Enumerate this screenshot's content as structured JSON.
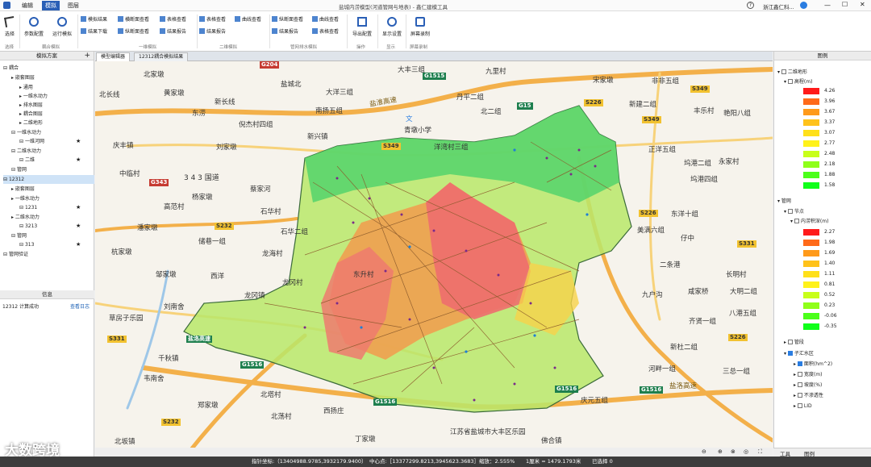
{
  "menu": {
    "file_icon": "app-icon",
    "items": [
      "编辑",
      "模拟",
      "图层"
    ],
    "active": "模拟"
  },
  "window": {
    "title": "盐城内涝模型(河道管网与地表) - 鑫仁建模工具",
    "user": "浙江鑫仁科...",
    "help_icon": "help-icon"
  },
  "ribbon": {
    "select": "选择",
    "param": "参数配置",
    "run": "运行模拟",
    "result_view": "模拟结果",
    "result_download": "结果下载",
    "h_section_view": "横断面查看",
    "v_section_view": "纵断面查看",
    "table_view": "表格查看",
    "result_report": "结果报告",
    "table_view2": "表格查看",
    "result_report2": "结果报告",
    "curve_view": "曲线查看",
    "v_section_view2": "纵断面查看",
    "result_report3": "结果报告",
    "curve_view2": "曲线查看",
    "table_view3": "表格查看",
    "export": "导出配置",
    "display": "显示设置",
    "record": "屏幕录制",
    "groups": {
      "g1": "选择",
      "g2": "耦合模拟",
      "g3": "一维模拟",
      "g4": "二维模拟",
      "g5": "管网排水模拟",
      "g6": "操作",
      "g7": "显示",
      "g8": "屏幕录制"
    }
  },
  "left": {
    "header": "模拟方案",
    "tree": [
      "耦合",
      "嵌套图层",
      "通用",
      "一维水动力",
      "排水图层",
      "耦合图层",
      "二维地形",
      "一维水动力",
      "一维河网",
      "二维水动力",
      "二维",
      "管网",
      "12312",
      "嵌套图层",
      "一维水动力",
      "1231",
      "二维水动力",
      "3213",
      "管网",
      "313",
      "管网验证"
    ],
    "info_header": "信息",
    "info_text": "12312 计算成功",
    "info_link": "查看日志"
  },
  "tabs": [
    "模型编辑器",
    "12312耦合模拟结果"
  ],
  "map": {
    "labels": [
      "北家墩",
      "黄家墩",
      "北长线",
      "新长线",
      "东涝",
      "倪杰村四组",
      "刘家墩",
      "庆丰镇",
      "中临村",
      "蔡家河",
      "杨家墩",
      "高范村",
      "潘家墩",
      "储巷一组",
      "杭家墩",
      "邹家墩",
      "西洋",
      "刘南舍",
      "草房子乐园",
      "千秋镇",
      "韦南舍",
      "郑家墩",
      "北坂镇",
      "北荡村",
      "北塔村",
      "西扬庄",
      "丁家墩",
      "江苏省盐城市大丰区乐园",
      "佛合镇",
      "大丰三组",
      "盐城北",
      "大洋三组",
      "南扬五组",
      "青墩小学",
      "洋湾村三组",
      "丹平二组",
      "新兴镇",
      "九里村",
      "北二组",
      "宋家墩",
      "非非五组",
      "新建二组",
      "丰乐村",
      "艳阳八组",
      "正洋五组",
      "坞港二组",
      "坞港四组",
      "美满六组",
      "东洋十组",
      "仔中",
      "二条港",
      "长明村",
      "大明二组",
      "永家村",
      "咸家桥",
      "八港五组",
      "九户沟",
      "齐贤一组",
      "新杜二组",
      "河畔一组",
      "三总一组",
      "庆元五组",
      "龙海村",
      "石华村",
      "石华二组",
      "龙冈镇",
      "龙冈村",
      "东升村"
    ],
    "roads": [
      "G204",
      "S349",
      "G1515",
      "G15",
      "S226",
      "S331",
      "S232",
      "G343",
      "G1516",
      "G228",
      "3 4 3 国道",
      "盐淮高速",
      "盐洛高速"
    ],
    "icon_doc": "文"
  },
  "legend": {
    "header": "图例",
    "sec1": "二维地形",
    "sec1_item": "高程(m)",
    "elev_values": [
      "4.26",
      "3.96",
      "3.67",
      "3.37",
      "3.07",
      "2.77",
      "2.48",
      "2.18",
      "1.88",
      "1.58"
    ],
    "elev_colors": [
      "#ff1a1a",
      "#ff6a1a",
      "#ff9a1a",
      "#ffc21a",
      "#ffe01a",
      "#fff21a",
      "#c8ff1a",
      "#8fff1a",
      "#4cff1a",
      "#10ff1a"
    ],
    "sec2": "管网",
    "sec2_item": "节点",
    "sec2_sub": "内涝积深(m)",
    "depth_values": [
      "2.27",
      "1.98",
      "1.69",
      "1.40",
      "1.11",
      "0.81",
      "0.52",
      "0.23",
      "-0.06",
      "-0.35"
    ],
    "depth_colors": [
      "#ff1a1a",
      "#ff6a1a",
      "#ff9a1a",
      "#ffc21a",
      "#ffe01a",
      "#fff21a",
      "#c8ff1a",
      "#8fff1a",
      "#4cff1a",
      "#10ff1a"
    ],
    "sec3": "管段",
    "sec4": "子汇水区",
    "sub_items": [
      "面积(hm^2)",
      "宽度(m)",
      "坡度(%)",
      "不渗透性",
      "LID"
    ]
  },
  "bottom_tabs": [
    "工具",
    "图例"
  ],
  "status": {
    "coord": "指针坐标:（13404988.9785,3932179.9400）",
    "center": "中心点:［13377299.8213,3945623.3683］",
    "zoom": "缩放：2.555%",
    "scale": "1厘米 = 1479.1793米",
    "selected": "已选择 0"
  },
  "watermark": "大数跨境"
}
